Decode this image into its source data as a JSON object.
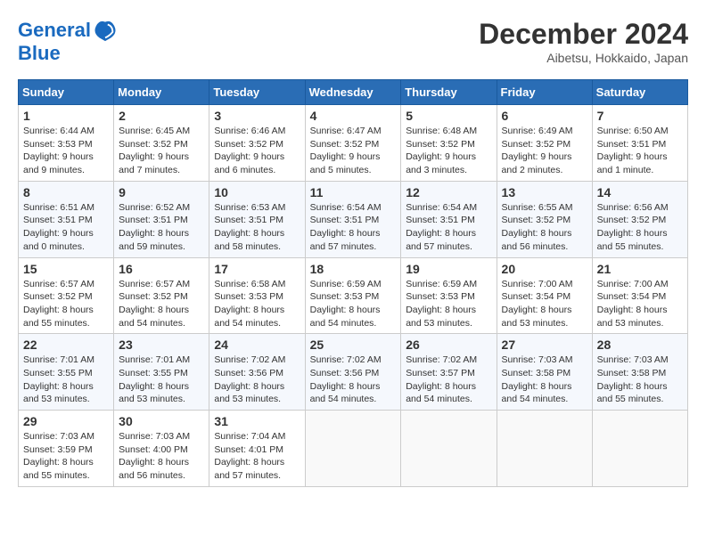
{
  "logo": {
    "line1": "General",
    "line2": "Blue"
  },
  "title": "December 2024",
  "location": "Aibetsu, Hokkaido, Japan",
  "weekdays": [
    "Sunday",
    "Monday",
    "Tuesday",
    "Wednesday",
    "Thursday",
    "Friday",
    "Saturday"
  ],
  "weeks": [
    [
      {
        "day": "1",
        "info": "Sunrise: 6:44 AM\nSunset: 3:53 PM\nDaylight: 9 hours\nand 9 minutes."
      },
      {
        "day": "2",
        "info": "Sunrise: 6:45 AM\nSunset: 3:52 PM\nDaylight: 9 hours\nand 7 minutes."
      },
      {
        "day": "3",
        "info": "Sunrise: 6:46 AM\nSunset: 3:52 PM\nDaylight: 9 hours\nand 6 minutes."
      },
      {
        "day": "4",
        "info": "Sunrise: 6:47 AM\nSunset: 3:52 PM\nDaylight: 9 hours\nand 5 minutes."
      },
      {
        "day": "5",
        "info": "Sunrise: 6:48 AM\nSunset: 3:52 PM\nDaylight: 9 hours\nand 3 minutes."
      },
      {
        "day": "6",
        "info": "Sunrise: 6:49 AM\nSunset: 3:52 PM\nDaylight: 9 hours\nand 2 minutes."
      },
      {
        "day": "7",
        "info": "Sunrise: 6:50 AM\nSunset: 3:51 PM\nDaylight: 9 hours\nand 1 minute."
      }
    ],
    [
      {
        "day": "8",
        "info": "Sunrise: 6:51 AM\nSunset: 3:51 PM\nDaylight: 9 hours\nand 0 minutes."
      },
      {
        "day": "9",
        "info": "Sunrise: 6:52 AM\nSunset: 3:51 PM\nDaylight: 8 hours\nand 59 minutes."
      },
      {
        "day": "10",
        "info": "Sunrise: 6:53 AM\nSunset: 3:51 PM\nDaylight: 8 hours\nand 58 minutes."
      },
      {
        "day": "11",
        "info": "Sunrise: 6:54 AM\nSunset: 3:51 PM\nDaylight: 8 hours\nand 57 minutes."
      },
      {
        "day": "12",
        "info": "Sunrise: 6:54 AM\nSunset: 3:51 PM\nDaylight: 8 hours\nand 57 minutes."
      },
      {
        "day": "13",
        "info": "Sunrise: 6:55 AM\nSunset: 3:52 PM\nDaylight: 8 hours\nand 56 minutes."
      },
      {
        "day": "14",
        "info": "Sunrise: 6:56 AM\nSunset: 3:52 PM\nDaylight: 8 hours\nand 55 minutes."
      }
    ],
    [
      {
        "day": "15",
        "info": "Sunrise: 6:57 AM\nSunset: 3:52 PM\nDaylight: 8 hours\nand 55 minutes."
      },
      {
        "day": "16",
        "info": "Sunrise: 6:57 AM\nSunset: 3:52 PM\nDaylight: 8 hours\nand 54 minutes."
      },
      {
        "day": "17",
        "info": "Sunrise: 6:58 AM\nSunset: 3:53 PM\nDaylight: 8 hours\nand 54 minutes."
      },
      {
        "day": "18",
        "info": "Sunrise: 6:59 AM\nSunset: 3:53 PM\nDaylight: 8 hours\nand 54 minutes."
      },
      {
        "day": "19",
        "info": "Sunrise: 6:59 AM\nSunset: 3:53 PM\nDaylight: 8 hours\nand 53 minutes."
      },
      {
        "day": "20",
        "info": "Sunrise: 7:00 AM\nSunset: 3:54 PM\nDaylight: 8 hours\nand 53 minutes."
      },
      {
        "day": "21",
        "info": "Sunrise: 7:00 AM\nSunset: 3:54 PM\nDaylight: 8 hours\nand 53 minutes."
      }
    ],
    [
      {
        "day": "22",
        "info": "Sunrise: 7:01 AM\nSunset: 3:55 PM\nDaylight: 8 hours\nand 53 minutes."
      },
      {
        "day": "23",
        "info": "Sunrise: 7:01 AM\nSunset: 3:55 PM\nDaylight: 8 hours\nand 53 minutes."
      },
      {
        "day": "24",
        "info": "Sunrise: 7:02 AM\nSunset: 3:56 PM\nDaylight: 8 hours\nand 53 minutes."
      },
      {
        "day": "25",
        "info": "Sunrise: 7:02 AM\nSunset: 3:56 PM\nDaylight: 8 hours\nand 54 minutes."
      },
      {
        "day": "26",
        "info": "Sunrise: 7:02 AM\nSunset: 3:57 PM\nDaylight: 8 hours\nand 54 minutes."
      },
      {
        "day": "27",
        "info": "Sunrise: 7:03 AM\nSunset: 3:58 PM\nDaylight: 8 hours\nand 54 minutes."
      },
      {
        "day": "28",
        "info": "Sunrise: 7:03 AM\nSunset: 3:58 PM\nDaylight: 8 hours\nand 55 minutes."
      }
    ],
    [
      {
        "day": "29",
        "info": "Sunrise: 7:03 AM\nSunset: 3:59 PM\nDaylight: 8 hours\nand 55 minutes."
      },
      {
        "day": "30",
        "info": "Sunrise: 7:03 AM\nSunset: 4:00 PM\nDaylight: 8 hours\nand 56 minutes."
      },
      {
        "day": "31",
        "info": "Sunrise: 7:04 AM\nSunset: 4:01 PM\nDaylight: 8 hours\nand 57 minutes."
      },
      null,
      null,
      null,
      null
    ]
  ]
}
